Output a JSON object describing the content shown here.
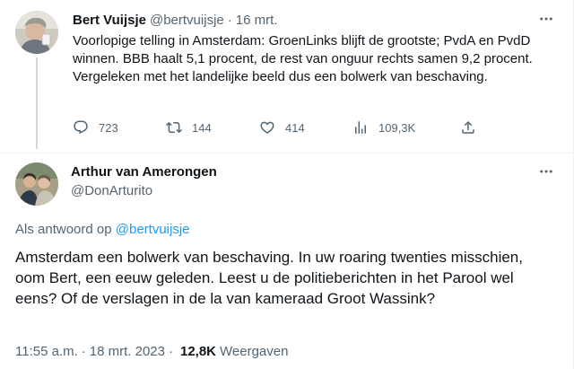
{
  "parent_tweet": {
    "author_name": "Bert Vuijsje",
    "handle": "@bertvuijsje",
    "separator": "·",
    "date": "16 mrt.",
    "text": "Voorlopige telling in Amsterdam: GroenLinks blijft de grootste; PvdA en PvdD winnen. BBB haalt 5,1 procent, de rest van onguur rechts samen 9,2 procent. Vergeleken met het landelijke beeld dus een bolwerk van beschaving.",
    "actions": {
      "reply_count": "723",
      "retweet_count": "144",
      "like_count": "414",
      "views_count": "109,3K"
    }
  },
  "focal_tweet": {
    "author_name": "Arthur van Amerongen",
    "handle": "@DonArturito",
    "reply_prefix": "Als antwoord op",
    "reply_to": "@bertvuijsje",
    "text": "Amsterdam een bolwerk van beschaving. In uw roaring twenties misschien, oom Bert, een eeuw geleden. Leest u de politieberichten in het Parool wel eens? Of de verslagen in de la van kameraad Groot Wassink?",
    "time": "11:55 a.m.",
    "separator": "·",
    "date": "18 mrt. 2023",
    "views_count": "12,8K",
    "views_label": "Weergaven"
  },
  "colors": {
    "text_primary": "#0f1419",
    "text_secondary": "#536471",
    "link": "#1d9bf0",
    "divider": "#eff3f4"
  },
  "icons": [
    "more-icon",
    "reply-icon",
    "retweet-icon",
    "like-icon",
    "views-icon",
    "share-icon"
  ]
}
